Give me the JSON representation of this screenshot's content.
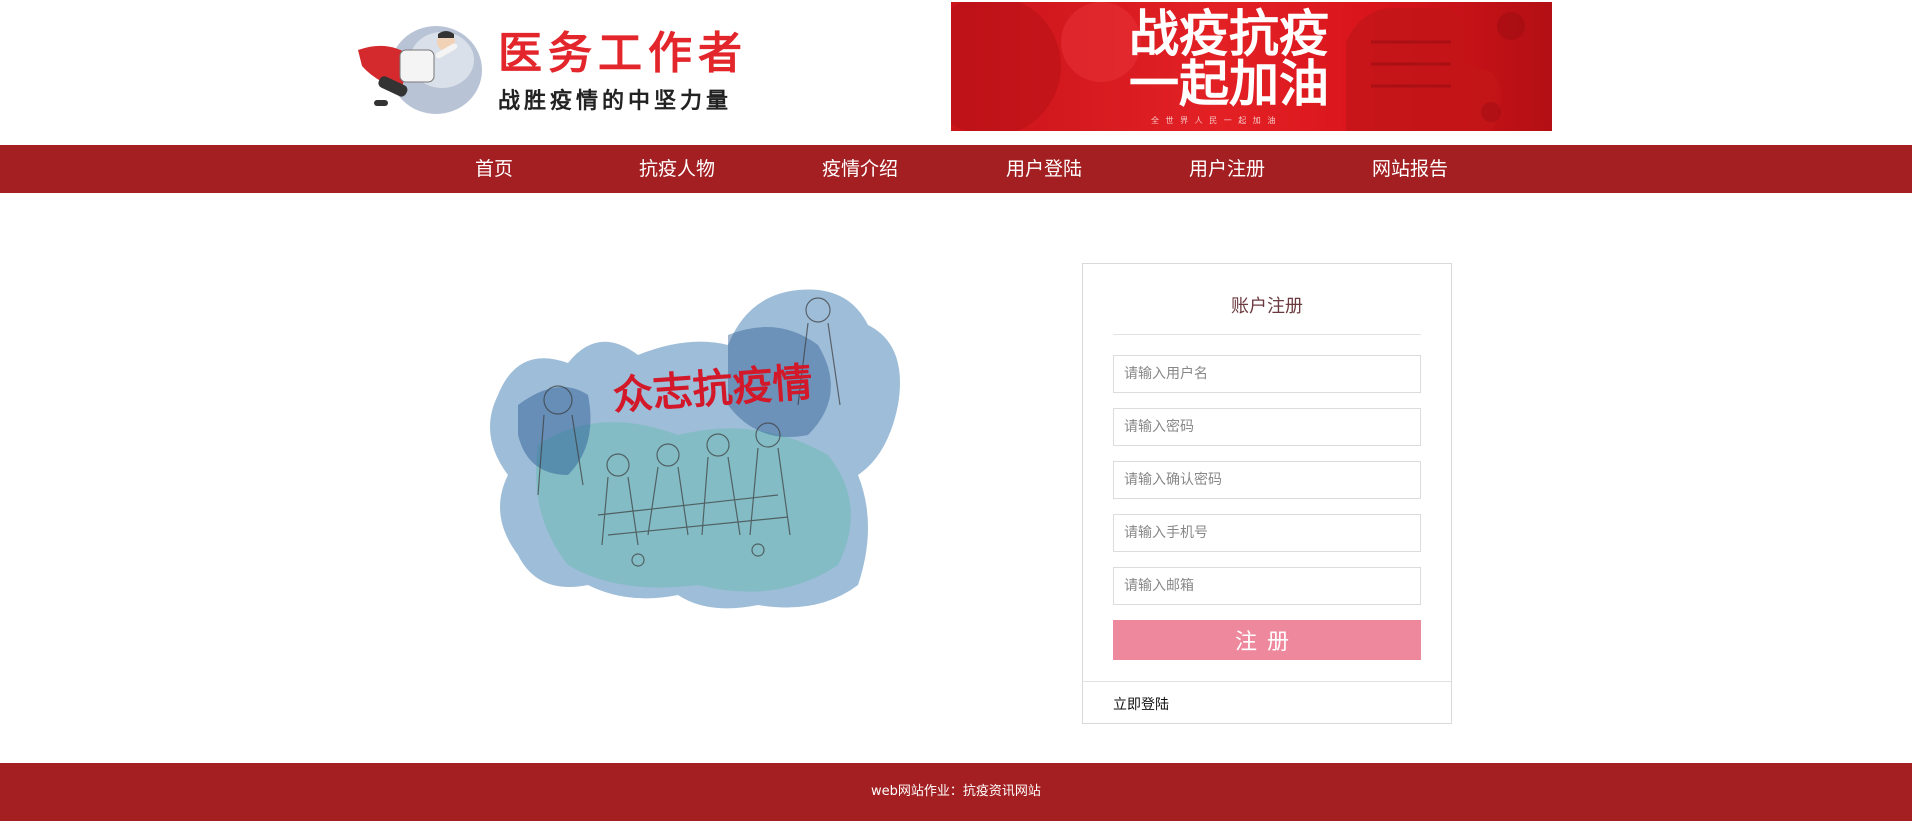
{
  "header": {
    "logo_title": "医务工作者",
    "logo_subtitle": "战胜疫情的中坚力量",
    "banner_line1": "战疫抗疫",
    "banner_line2": "一起加油",
    "banner_small": "全 世 界 人 民 一 起 加 油"
  },
  "nav": {
    "items": [
      {
        "label": "首页"
      },
      {
        "label": "抗疫人物"
      },
      {
        "label": "疫情介绍"
      },
      {
        "label": "用户登陆"
      },
      {
        "label": "用户注册"
      },
      {
        "label": "网站报告"
      }
    ]
  },
  "illustration": {
    "calligraphy": "众志抗疫情"
  },
  "form": {
    "title": "账户注册",
    "username_placeholder": "请输入用户名",
    "password_placeholder": "请输入密码",
    "confirm_placeholder": "请输入确认密码",
    "phone_placeholder": "请输入手机号",
    "email_placeholder": "请输入邮箱",
    "submit_label": "注册",
    "login_link": "立即登陆"
  },
  "footer": {
    "text": "web网站作业：抗疫资讯网站"
  },
  "colors": {
    "primary_red": "#a31f22",
    "accent_red": "#e3262b",
    "submit_pink": "#ee889c"
  }
}
